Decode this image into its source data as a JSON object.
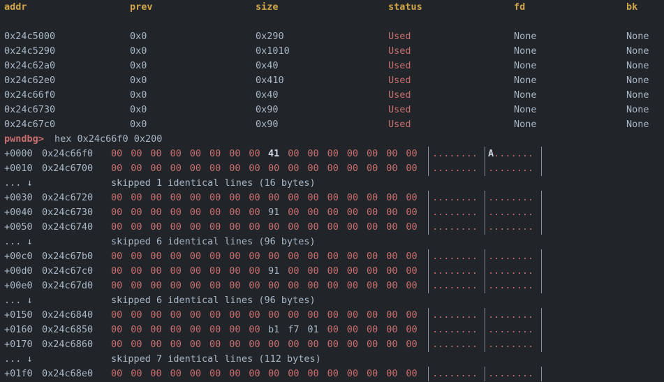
{
  "heap_table": {
    "headers": {
      "addr": "addr",
      "prev": "prev",
      "size": "size",
      "status": "status",
      "fd": "fd",
      "bk": "bk"
    },
    "rows": [
      {
        "addr": "0x24c5000",
        "prev": "0x0",
        "size": "0x290",
        "status": "Used",
        "fd": "None",
        "bk": "None"
      },
      {
        "addr": "0x24c5290",
        "prev": "0x0",
        "size": "0x1010",
        "status": "Used",
        "fd": "None",
        "bk": "None"
      },
      {
        "addr": "0x24c62a0",
        "prev": "0x0",
        "size": "0x40",
        "status": "Used",
        "fd": "None",
        "bk": "None"
      },
      {
        "addr": "0x24c62e0",
        "prev": "0x0",
        "size": "0x410",
        "status": "Used",
        "fd": "None",
        "bk": "None"
      },
      {
        "addr": "0x24c66f0",
        "prev": "0x0",
        "size": "0x40",
        "status": "Used",
        "fd": "None",
        "bk": "None"
      },
      {
        "addr": "0x24c6730",
        "prev": "0x0",
        "size": "0x90",
        "status": "Used",
        "fd": "None",
        "bk": "None"
      },
      {
        "addr": "0x24c67c0",
        "prev": "0x0",
        "size": "0x90",
        "status": "Used",
        "fd": "None",
        "bk": "None"
      }
    ]
  },
  "prompt": {
    "label": "pwndbg>",
    "command": "hex 0x24c66f0 0x200"
  },
  "hexdump": [
    {
      "type": "line",
      "offset": "+0000",
      "address": "0x24c66f0",
      "bytes": [
        "00",
        "00",
        "00",
        "00",
        "00",
        "00",
        "00",
        "00",
        "41",
        "00",
        "00",
        "00",
        "00",
        "00",
        "00",
        "00"
      ],
      "ascii_left": "........",
      "ascii_right": "A......."
    },
    {
      "type": "line",
      "offset": "+0010",
      "address": "0x24c6700",
      "bytes": [
        "00",
        "00",
        "00",
        "00",
        "00",
        "00",
        "00",
        "00",
        "00",
        "00",
        "00",
        "00",
        "00",
        "00",
        "00",
        "00"
      ],
      "ascii_left": "........",
      "ascii_right": "........"
    },
    {
      "type": "skip",
      "marker": "... ↓",
      "text": "skipped 1 identical lines (16 bytes)"
    },
    {
      "type": "line",
      "offset": "+0030",
      "address": "0x24c6720",
      "bytes": [
        "00",
        "00",
        "00",
        "00",
        "00",
        "00",
        "00",
        "00",
        "00",
        "00",
        "00",
        "00",
        "00",
        "00",
        "00",
        "00"
      ],
      "ascii_left": "........",
      "ascii_right": "........"
    },
    {
      "type": "line",
      "offset": "+0040",
      "address": "0x24c6730",
      "bytes": [
        "00",
        "00",
        "00",
        "00",
        "00",
        "00",
        "00",
        "00",
        "91",
        "00",
        "00",
        "00",
        "00",
        "00",
        "00",
        "00"
      ],
      "ascii_left": "........",
      "ascii_right": "........"
    },
    {
      "type": "line",
      "offset": "+0050",
      "address": "0x24c6740",
      "bytes": [
        "00",
        "00",
        "00",
        "00",
        "00",
        "00",
        "00",
        "00",
        "00",
        "00",
        "00",
        "00",
        "00",
        "00",
        "00",
        "00"
      ],
      "ascii_left": "........",
      "ascii_right": "........"
    },
    {
      "type": "skip",
      "marker": "... ↓",
      "text": "skipped 6 identical lines (96 bytes)"
    },
    {
      "type": "line",
      "offset": "+00c0",
      "address": "0x24c67b0",
      "bytes": [
        "00",
        "00",
        "00",
        "00",
        "00",
        "00",
        "00",
        "00",
        "00",
        "00",
        "00",
        "00",
        "00",
        "00",
        "00",
        "00"
      ],
      "ascii_left": "........",
      "ascii_right": "........"
    },
    {
      "type": "line",
      "offset": "+00d0",
      "address": "0x24c67c0",
      "bytes": [
        "00",
        "00",
        "00",
        "00",
        "00",
        "00",
        "00",
        "00",
        "91",
        "00",
        "00",
        "00",
        "00",
        "00",
        "00",
        "00"
      ],
      "ascii_left": "........",
      "ascii_right": "........"
    },
    {
      "type": "line",
      "offset": "+00e0",
      "address": "0x24c67d0",
      "bytes": [
        "00",
        "00",
        "00",
        "00",
        "00",
        "00",
        "00",
        "00",
        "00",
        "00",
        "00",
        "00",
        "00",
        "00",
        "00",
        "00"
      ],
      "ascii_left": "........",
      "ascii_right": "........"
    },
    {
      "type": "skip",
      "marker": "... ↓",
      "text": "skipped 6 identical lines (96 bytes)"
    },
    {
      "type": "line",
      "offset": "+0150",
      "address": "0x24c6840",
      "bytes": [
        "00",
        "00",
        "00",
        "00",
        "00",
        "00",
        "00",
        "00",
        "00",
        "00",
        "00",
        "00",
        "00",
        "00",
        "00",
        "00"
      ],
      "ascii_left": "........",
      "ascii_right": "........"
    },
    {
      "type": "line",
      "offset": "+0160",
      "address": "0x24c6850",
      "bytes": [
        "00",
        "00",
        "00",
        "00",
        "00",
        "00",
        "00",
        "00",
        "b1",
        "f7",
        "01",
        "00",
        "00",
        "00",
        "00",
        "00"
      ],
      "ascii_left": "........",
      "ascii_right": "........"
    },
    {
      "type": "line",
      "offset": "+0170",
      "address": "0x24c6860",
      "bytes": [
        "00",
        "00",
        "00",
        "00",
        "00",
        "00",
        "00",
        "00",
        "00",
        "00",
        "00",
        "00",
        "00",
        "00",
        "00",
        "00"
      ],
      "ascii_left": "........",
      "ascii_right": "........"
    },
    {
      "type": "skip",
      "marker": "... ↓",
      "text": "skipped 7 identical lines (112 bytes)"
    },
    {
      "type": "line",
      "offset": "+01f0",
      "address": "0x24c68e0",
      "bytes": [
        "00",
        "00",
        "00",
        "00",
        "00",
        "00",
        "00",
        "00",
        "00",
        "00",
        "00",
        "00",
        "00",
        "00",
        "00",
        "00"
      ],
      "ascii_left": "........",
      "ascii_right": "........"
    }
  ]
}
